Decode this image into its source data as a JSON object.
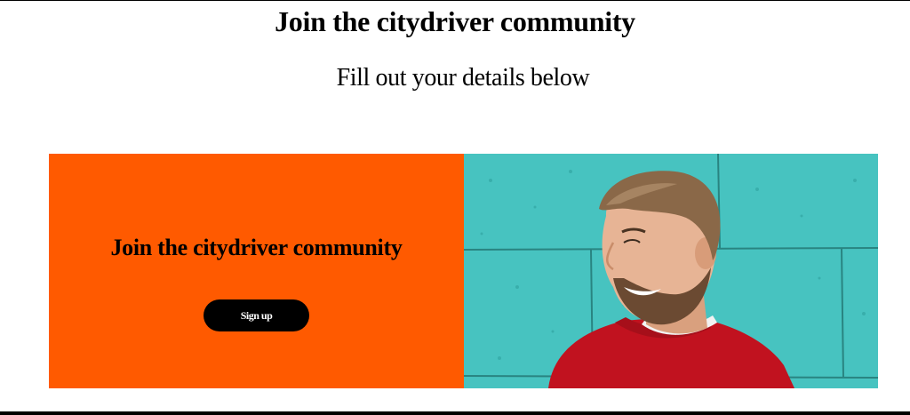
{
  "header": {
    "title": "Join the citydriver community",
    "subtitle": "Fill out your details below"
  },
  "promo": {
    "title": "Join the citydriver community",
    "button_label": "Sign up",
    "background_color": "#ff5a00",
    "button_color": "#000000"
  },
  "photo": {
    "icon": "smiling-man-photo",
    "wall_color": "#4cc9c5",
    "sweater_color": "#c1121f"
  }
}
